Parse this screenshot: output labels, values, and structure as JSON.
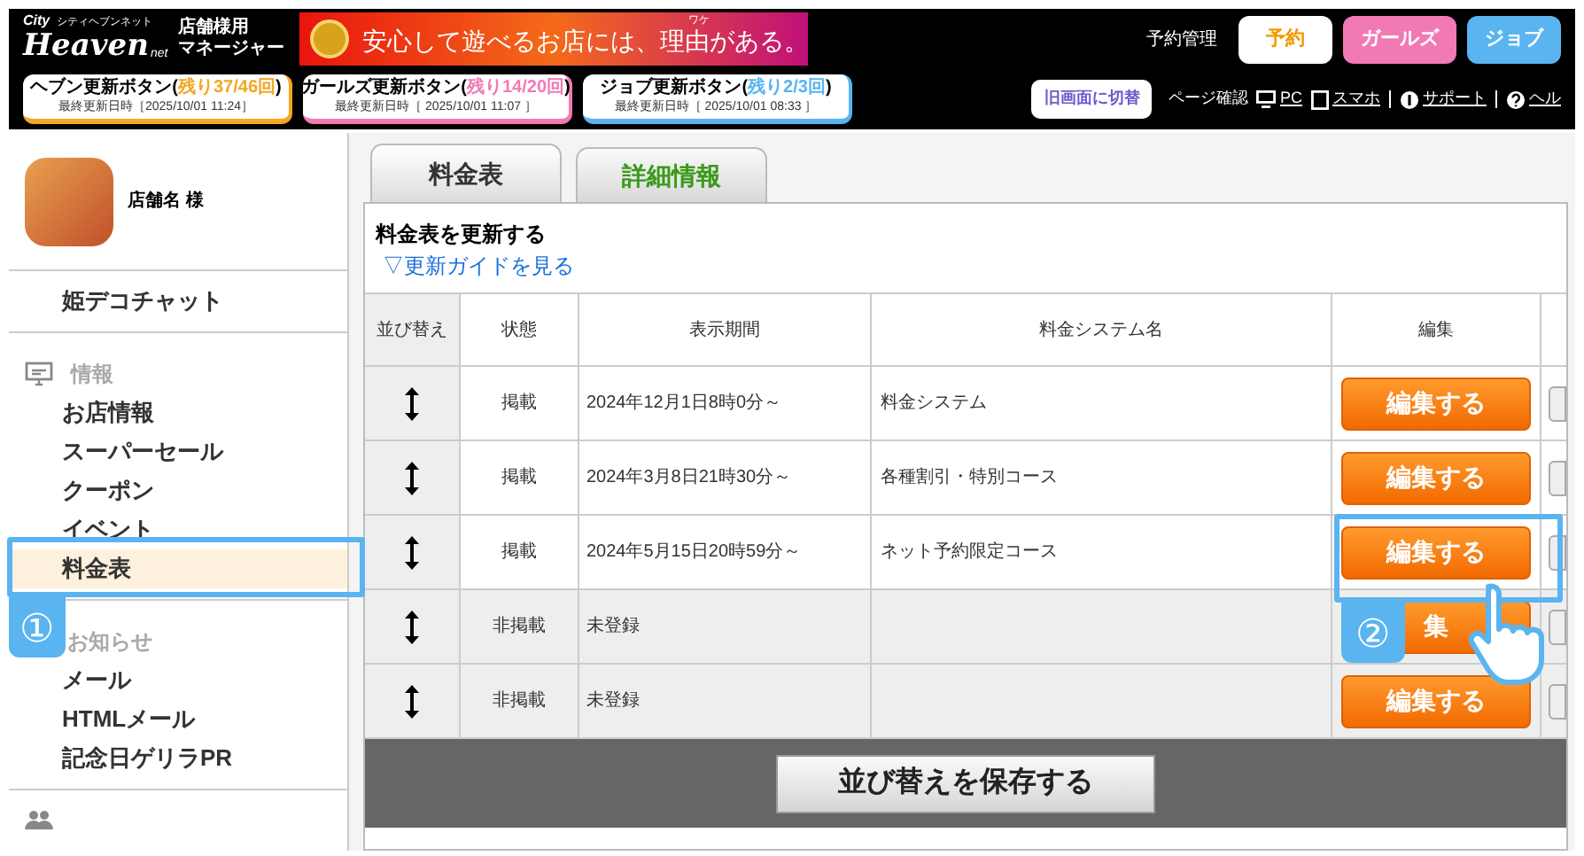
{
  "header": {
    "logo": {
      "small": "City",
      "kana": "シティヘブンネット",
      "main": "Heaven",
      "tail": "net"
    },
    "manager_label": [
      "店舗様用",
      "マネージャー"
    ],
    "banner": {
      "ruby": "ワケ",
      "text": "安心して遊べるお店には、理由がある。"
    },
    "reservation_label": "予約管理",
    "nav_buttons": [
      {
        "label": "予約",
        "kind": "outline",
        "color": "#f39800"
      },
      {
        "label": "ガールズ",
        "kind": "filled",
        "color": "#f27ab4"
      },
      {
        "label": "ジョブ",
        "kind": "filled",
        "color": "#5ab4f0"
      }
    ],
    "update_buttons": [
      {
        "title": "ヘブン更新ボタン(",
        "remaining": "残り37/46回",
        "title_end": ")",
        "updated": "最終更新日時［2025/10/01 11:24］",
        "color": "#f5a623"
      },
      {
        "title": "ガールズ更新ボタン(",
        "remaining": "残り14/20回",
        "title_end": ")",
        "updated": "最終更新日時［ 2025/10/01 11:07 ］",
        "color": "#f27ab4"
      },
      {
        "title": "ジョブ更新ボタン(",
        "remaining": "残り2/3回",
        "title_end": ")",
        "updated": "最終更新日時［ 2025/10/01 08:33 ］",
        "color": "#5ab4f0"
      }
    ],
    "old_screen_button": "旧画面に切替",
    "page_check_label": "ページ確認",
    "links": [
      {
        "label": "PC",
        "kind": "pc"
      },
      {
        "label": "スマホ",
        "kind": "phone"
      },
      {
        "label": "サポート",
        "kind": "support"
      },
      {
        "label": "ヘル",
        "kind": "help"
      }
    ]
  },
  "sidebar": {
    "profile": {
      "name": "店舗名 様"
    },
    "sections": [
      {
        "items": [
          {
            "label": "姫デコチャット",
            "selected": false
          }
        ]
      },
      {
        "title": "情報",
        "items": [
          {
            "label": "お店情報",
            "selected": false
          },
          {
            "label": "スーパーセール",
            "selected": false
          },
          {
            "label": "クーポン",
            "selected": false
          },
          {
            "label": "イベント",
            "selected": false
          },
          {
            "label": "料金表",
            "selected": true
          }
        ]
      },
      {
        "title": "お知らせ",
        "items": [
          {
            "label": "メール",
            "selected": false
          },
          {
            "label": "HTMLメール",
            "selected": false
          },
          {
            "label": "記念日ゲリラPR",
            "selected": false
          }
        ]
      }
    ]
  },
  "main": {
    "tabs": [
      {
        "label": "料金表",
        "selected": true
      },
      {
        "label": "詳細情報",
        "selected": false
      }
    ],
    "heading": "料金表を更新する",
    "guide_link": "▽更新ガイドを見る",
    "table": {
      "columns": [
        "並び替え",
        "状態",
        "表示期間",
        "料金システム名",
        "編集"
      ],
      "rows": [
        {
          "status": "掲載",
          "period": "2024年12月1日8時0分～",
          "name": "料金システム",
          "published": true,
          "button": "編集する"
        },
        {
          "status": "掲載",
          "period": "2024年3月8日21時30分～",
          "name": "各種割引・特別コース",
          "published": true,
          "button": "編集する"
        },
        {
          "status": "掲載",
          "period": "2024年5月15日20時59分～",
          "name": "ネット予約限定コース",
          "published": true,
          "button": "編集する"
        },
        {
          "status": "非掲載",
          "period": "未登録",
          "name": "",
          "published": false,
          "button": "集"
        },
        {
          "status": "非掲載",
          "period": "未登録",
          "name": "",
          "published": false,
          "button": "編集する"
        }
      ]
    },
    "save_button": "並び替えを保存する"
  },
  "annotations": [
    {
      "number": "①"
    },
    {
      "number": "②"
    }
  ]
}
